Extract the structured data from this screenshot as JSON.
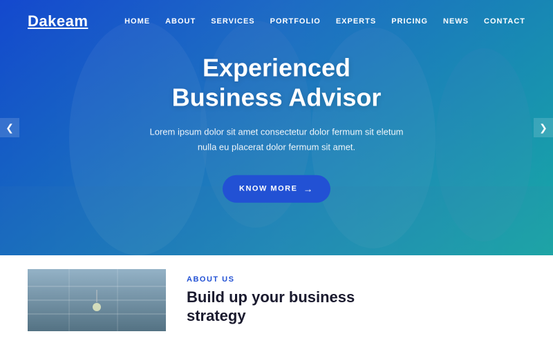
{
  "header": {
    "logo": "Dakeam",
    "nav": [
      {
        "label": "HOME",
        "name": "nav-home"
      },
      {
        "label": "ABOUT",
        "name": "nav-about"
      },
      {
        "label": "SERVICES",
        "name": "nav-services"
      },
      {
        "label": "PORTFOLIO",
        "name": "nav-portfolio"
      },
      {
        "label": "EXPERTS",
        "name": "nav-experts"
      },
      {
        "label": "PRICING",
        "name": "nav-pricing"
      },
      {
        "label": "NEWS",
        "name": "nav-news"
      },
      {
        "label": "CONTACT",
        "name": "nav-contact"
      }
    ]
  },
  "hero": {
    "title": "Experienced\nBusiness Advisor",
    "description": "Lorem ipsum dolor sit amet consectetur dolor fermum sit eletum\nnulla eu placerat dolor fermum sit amet.",
    "cta_label": "KNOW MORE",
    "arrow_left": "❮",
    "arrow_right": "❯"
  },
  "about": {
    "label": "ABOUT US",
    "title": "Build up your business\nstrategy"
  },
  "colors": {
    "accent": "#2251d4",
    "text_dark": "#1a1a2e",
    "white": "#ffffff"
  }
}
